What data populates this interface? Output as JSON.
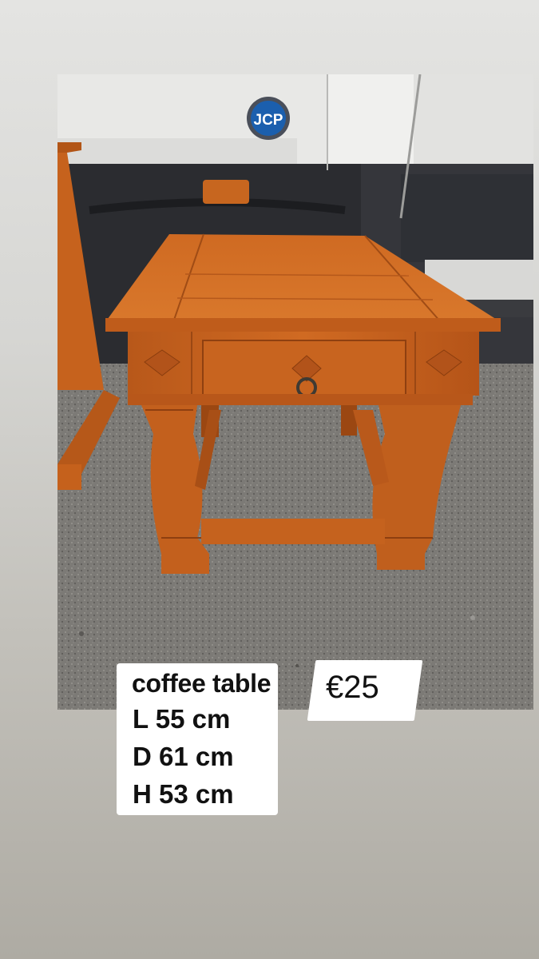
{
  "story": {
    "photo_alt": "coffee table",
    "van_badge": "JCP",
    "caption": {
      "title": "coffee table",
      "length": "L 55 cm",
      "depth": "D 61 cm",
      "height": "H 53 cm"
    },
    "price": "€25"
  },
  "colors": {
    "wood": "#c8631c",
    "wood_dark": "#9b4712",
    "ground": "#7a7874",
    "van": "#e6e6e4"
  }
}
